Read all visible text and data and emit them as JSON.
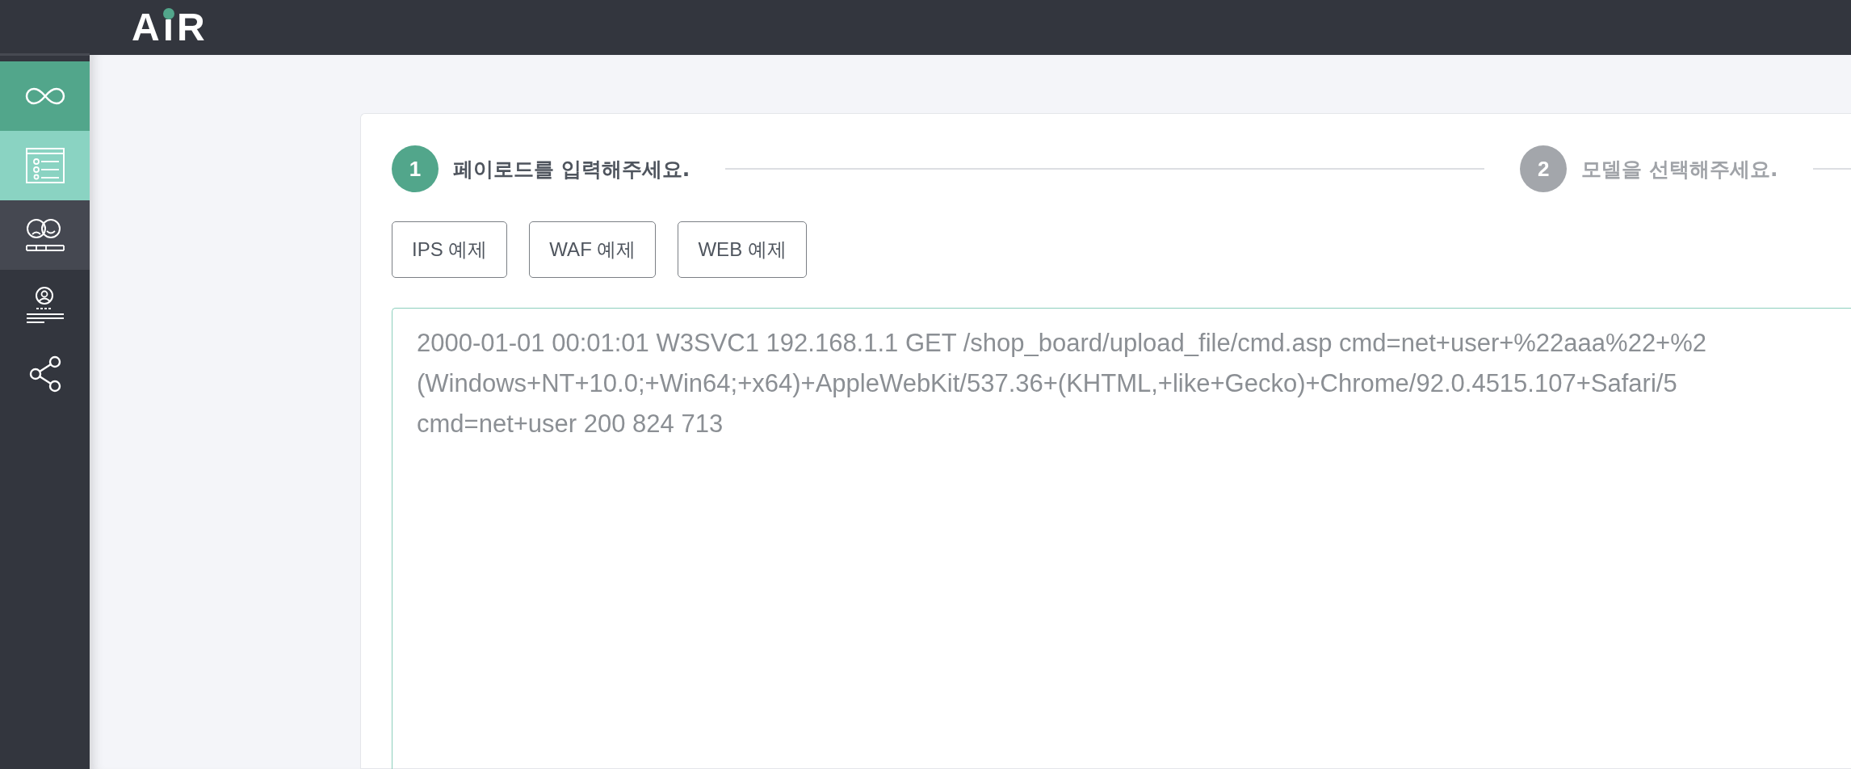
{
  "header": {
    "logo": {
      "main": "A",
      "dot_letter": "i",
      "tail": "R"
    }
  },
  "sidebar": {
    "items": [
      {
        "kind": "infinity",
        "selected": false,
        "expanded": true,
        "hovered": false
      },
      {
        "kind": "list",
        "selected": true,
        "expanded": false,
        "hovered": false
      },
      {
        "kind": "faces",
        "selected": false,
        "expanded": false,
        "hovered": true
      },
      {
        "kind": "profile",
        "selected": false,
        "expanded": false,
        "hovered": false
      },
      {
        "kind": "share",
        "selected": false,
        "expanded": false,
        "hovered": false
      }
    ]
  },
  "steps": [
    {
      "number": "1",
      "label": "페이로드를 입력해주세요.",
      "selected": true
    },
    {
      "number": "2",
      "label": "모델을 선택해주세요.",
      "selected": false
    }
  ],
  "example_buttons": [
    "IPS 예제",
    "WAF 예제",
    "WEB 예제"
  ],
  "payload": {
    "lines": [
      "2000-01-01 00:01:01 W3SVC1 192.168.1.1 GET /shop_board/upload_file/cmd.asp cmd=net+user+%22aaa%22+%2",
      "(Windows+NT+10.0;+Win64;+x64)+AppleWebKit/537.36+(KHTML,+like+Gecko)+Chrome/92.0.4515.107+Safari/5",
      "cmd=net+user 200 824 713"
    ]
  }
}
